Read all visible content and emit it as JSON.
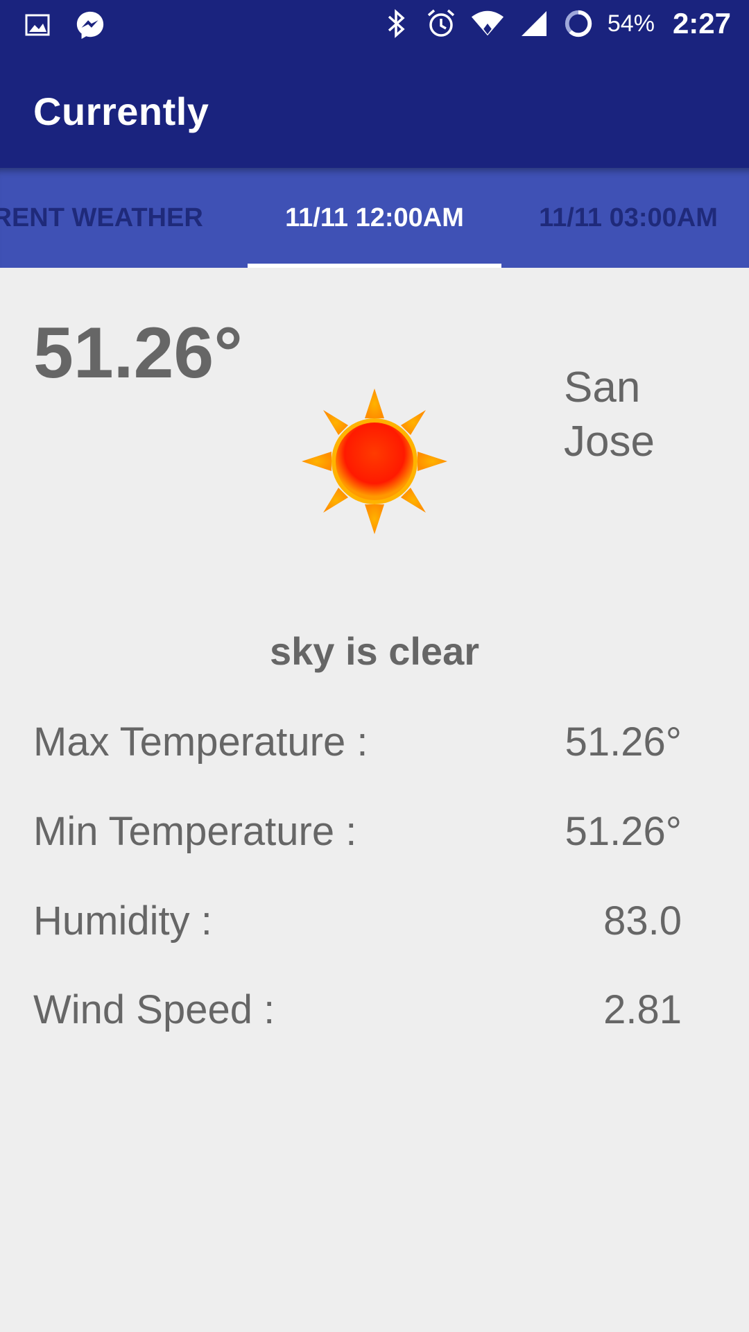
{
  "status_bar": {
    "battery_percent": "54%",
    "time": "2:27",
    "icons": [
      "gallery-icon",
      "messenger-icon",
      "bluetooth-icon",
      "alarm-icon",
      "wifi-icon",
      "signal-icon",
      "battery-icon"
    ]
  },
  "app_bar": {
    "title": "Currently"
  },
  "tabs": [
    {
      "label": "CURRENT WEATHER",
      "active": false
    },
    {
      "label": "11/11 12:00AM",
      "active": true
    },
    {
      "label": "11/11 03:00AM",
      "active": false
    }
  ],
  "weather": {
    "temperature": "51.26°",
    "city": "San Jose",
    "icon": "sun-icon",
    "description": "sky is clear",
    "details": [
      {
        "label": "Max Temperature :",
        "value": "51.26°"
      },
      {
        "label": "Min Temperature :",
        "value": "51.26°"
      },
      {
        "label": "Humidity :",
        "value": "83.0"
      },
      {
        "label": "Wind Speed :",
        "value": "2.81"
      }
    ]
  },
  "colors": {
    "primary_dark": "#1a237e",
    "primary": "#3f51b5",
    "background": "#eeeeee",
    "text": "#666666"
  }
}
